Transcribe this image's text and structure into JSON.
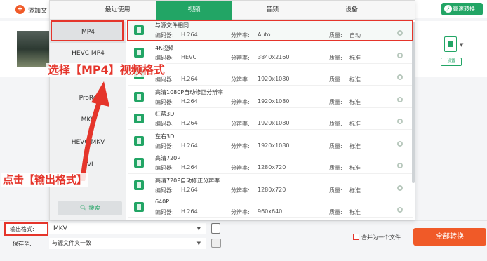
{
  "topbar": {
    "add_file_label": "添加文",
    "turbo_label": "高速转换"
  },
  "file_row": {
    "settings_label": "设置"
  },
  "tabs": [
    {
      "label": "最近使用",
      "active": false
    },
    {
      "label": "视频",
      "active": true
    },
    {
      "label": "音频",
      "active": false
    },
    {
      "label": "设备",
      "active": false
    }
  ],
  "categories": [
    {
      "label": "MP4",
      "active": true
    },
    {
      "label": "HEVC MP4",
      "active": false
    },
    {
      "label": "",
      "active": false
    },
    {
      "label": "ProRe",
      "active": false
    },
    {
      "label": "MKV",
      "active": false
    },
    {
      "label": "HEVC MKV",
      "active": false
    },
    {
      "label": "AVI",
      "active": false
    }
  ],
  "search_label": "搜索",
  "field_labels": {
    "encoder": "编码器:",
    "resolution": "分辨率:",
    "quality": "质量:"
  },
  "presets": [
    {
      "name": "与源文件相同",
      "encoder": "H.264",
      "resolution": "Auto",
      "quality": "自动",
      "selected": true
    },
    {
      "name": "4K视频",
      "encoder": "HEVC",
      "resolution": "3840x2160",
      "quality": "标准"
    },
    {
      "name": "",
      "encoder": "H.264",
      "resolution": "1920x1080",
      "quality": "标准"
    },
    {
      "name": "高清1080P自动修正分辨率",
      "encoder": "H.264",
      "resolution": "1920x1080",
      "quality": "标准"
    },
    {
      "name": "红蓝3D",
      "encoder": "H.264",
      "resolution": "1920x1080",
      "quality": "标准"
    },
    {
      "name": "左右3D",
      "encoder": "H.264",
      "resolution": "1920x1080",
      "quality": "标准"
    },
    {
      "name": "高清720P",
      "encoder": "H.264",
      "resolution": "1280x720",
      "quality": "标准"
    },
    {
      "name": "高清720P自动修正分辨率",
      "encoder": "H.264",
      "resolution": "1280x720",
      "quality": "标准"
    },
    {
      "name": "640P",
      "encoder": "H.264",
      "resolution": "960x640",
      "quality": "标准"
    }
  ],
  "bottom": {
    "output_format_label": "输出格式:",
    "output_format_value": "MKV",
    "save_to_label": "保存至:",
    "save_to_value": "与源文件夹一致",
    "merge_label": "合并为一个文件",
    "convert_all_label": "全部转换"
  },
  "annotations": {
    "select_mp4": "选择【MP4】视频格式",
    "click_output_format": "点击【输出格式】"
  },
  "colors": {
    "accent_green": "#22a565",
    "accent_orange": "#f05a28",
    "highlight_red": "#e5352b"
  }
}
